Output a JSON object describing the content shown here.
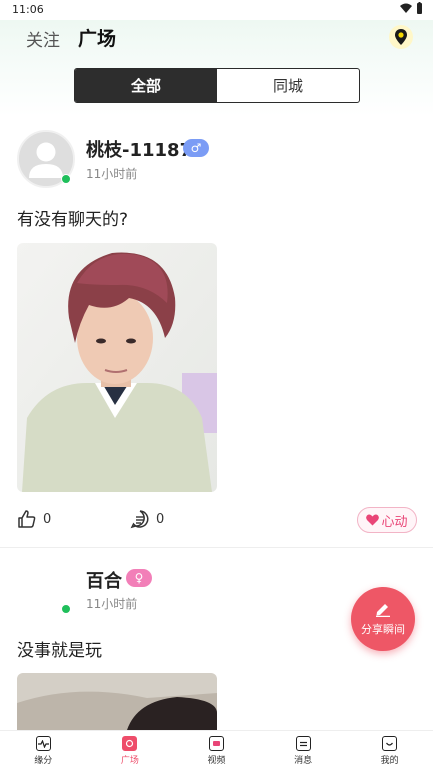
{
  "status_bar": {
    "time": "11:06"
  },
  "header": {
    "tabs": [
      {
        "label": "关注",
        "active": false
      },
      {
        "label": "广场",
        "active": true
      }
    ]
  },
  "segment": {
    "options": [
      {
        "label": "全部",
        "active": true
      },
      {
        "label": "同城",
        "active": false
      }
    ]
  },
  "posts": [
    {
      "username": "桃枝-11187",
      "gender_symbol": "♂",
      "gender": "male",
      "time": "11小时前",
      "text": "有没有聊天的?",
      "likes": "0",
      "comments": "0",
      "heart_label": "心动"
    },
    {
      "username": "百合",
      "gender_symbol": "♀",
      "gender": "female",
      "time": "11小时前",
      "text": "没事就是玩"
    }
  ],
  "fab": {
    "label": "分享瞬间"
  },
  "bottom_nav": [
    {
      "label": "缘分",
      "icon": "pulse-icon",
      "active": false
    },
    {
      "label": "广场",
      "icon": "square-icon",
      "active": true
    },
    {
      "label": "视频",
      "icon": "video-icon",
      "active": false
    },
    {
      "label": "消息",
      "icon": "message-icon",
      "active": false
    },
    {
      "label": "我的",
      "icon": "profile-icon",
      "active": false
    }
  ],
  "colors": {
    "accent": "#ee5766",
    "online": "#1fbf5b",
    "male": "#7b9cf5",
    "female": "#f27fb8"
  }
}
